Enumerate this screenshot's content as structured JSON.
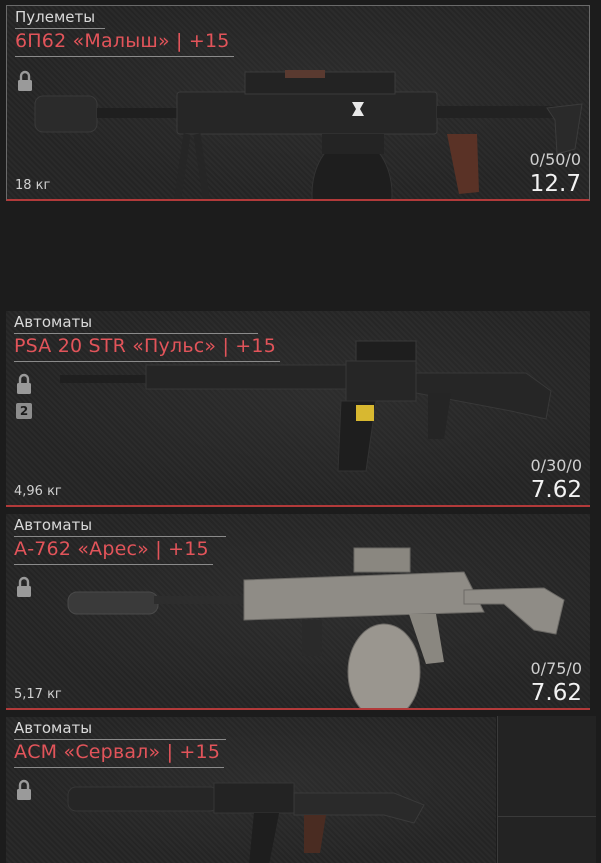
{
  "weapons": [
    {
      "category": "Пулеметы",
      "name": "6П62 «Малыш» | +15",
      "weight": "18 кг",
      "ammo": "0/50/0",
      "caliber": "12.7",
      "slots": null
    },
    {
      "category": "Автоматы",
      "name": "PSA 20 STR «Пульс» | +15",
      "weight": "4,96 кг",
      "ammo": "0/30/0",
      "caliber": "7.62",
      "slots": "2"
    },
    {
      "category": "Автоматы",
      "name": "А-762 «Арес» | +15",
      "weight": "5,17 кг",
      "ammo": "0/75/0",
      "caliber": "7.62",
      "slots": null
    },
    {
      "category": "Автоматы",
      "name": "АСМ «Сервал» | +15",
      "weight": "",
      "ammo": "",
      "caliber": "",
      "slots": null
    }
  ],
  "colors": {
    "accent": "#e2545a",
    "divider": "#b23a3a"
  },
  "icons": [
    "lock-icon",
    "machine-gun-image",
    "assault-rifle-image",
    "drum-rifle-image",
    "compact-rifle-image"
  ]
}
